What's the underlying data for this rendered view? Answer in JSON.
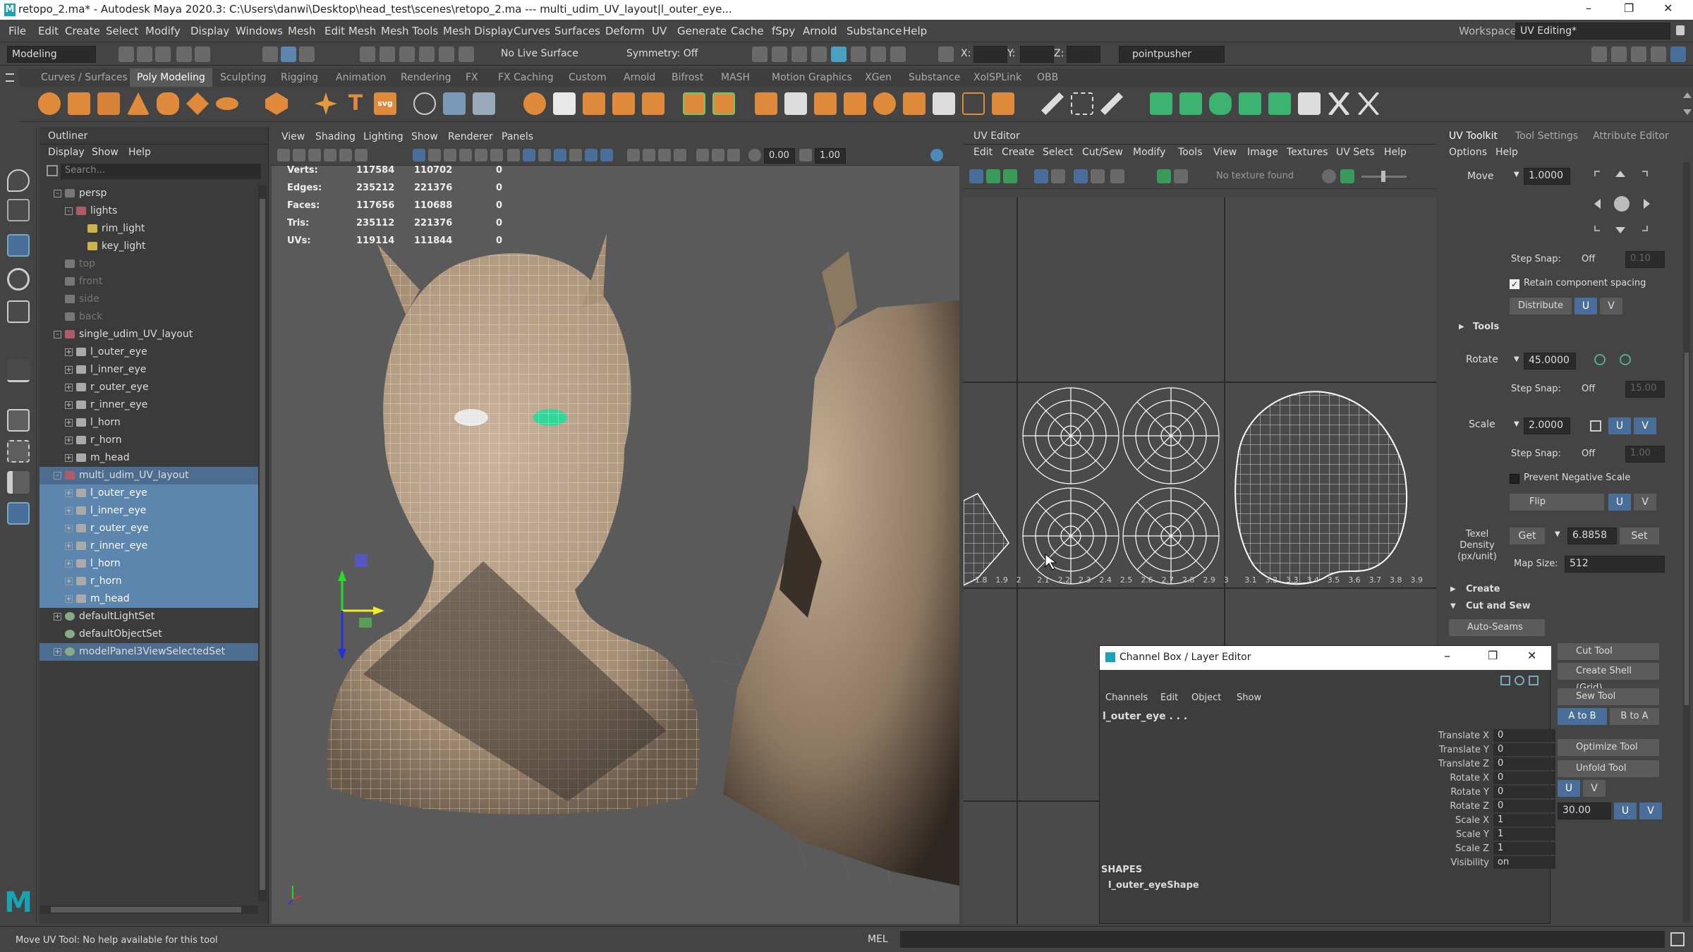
{
  "window": {
    "title": "retopo_2.ma* - Autodesk Maya 2020.3: C:\\Users\\danwi\\Desktop\\head_test\\scenes\\retopo_2.ma   ---   multi_udim_UV_layout|l_outer_eye...",
    "controls": [
      "–",
      "❐",
      "✕"
    ]
  },
  "menubar": {
    "items": [
      "File",
      "Edit",
      "Create",
      "Select",
      "Modify",
      "Display",
      "Windows",
      "Mesh",
      "Edit Mesh",
      "Mesh Tools",
      "Mesh Display",
      "Curves",
      "Surfaces",
      "Deform",
      "UV",
      "Generate",
      "Cache",
      "fSpy",
      "Arnold",
      "Substance",
      "Help"
    ],
    "workspace_label": "Workspace :",
    "workspace_value": "UV Editing*"
  },
  "statusline": {
    "menuset": "Modeling",
    "live_surface": "No Live Surface",
    "symmetry": "Symmetry: Off",
    "x_label": "X:",
    "y_label": "Y:",
    "z_label": "Z:",
    "user": "pointpusher"
  },
  "shelf_tabs": [
    "Curves / Surfaces",
    "Poly Modeling",
    "Sculpting",
    "Rigging",
    "Animation",
    "Rendering",
    "FX",
    "FX Caching",
    "Custom",
    "Arnold",
    "Bifrost",
    "MASH",
    "Motion Graphics",
    "XGen",
    "Substance",
    "XolSPLink",
    "OBB"
  ],
  "shelf_selected": "Poly Modeling",
  "outliner": {
    "title": "Outliner",
    "menu": [
      "Display",
      "Show",
      "Help"
    ],
    "search_placeholder": "Search...",
    "rows": [
      {
        "label": "persp",
        "indent": 1,
        "type": "cam",
        "exp": "-",
        "state": ""
      },
      {
        "label": "lights",
        "indent": 2,
        "type": "grp",
        "exp": "-",
        "state": ""
      },
      {
        "label": "rim_light",
        "indent": 3,
        "type": "light",
        "exp": "",
        "state": ""
      },
      {
        "label": "key_light",
        "indent": 3,
        "type": "light",
        "exp": "",
        "state": ""
      },
      {
        "label": "top",
        "indent": 1,
        "type": "cam",
        "exp": "",
        "state": "dim"
      },
      {
        "label": "front",
        "indent": 1,
        "type": "cam",
        "exp": "",
        "state": "dim"
      },
      {
        "label": "side",
        "indent": 1,
        "type": "cam",
        "exp": "",
        "state": "dim"
      },
      {
        "label": "back",
        "indent": 1,
        "type": "cam",
        "exp": "",
        "state": "dim"
      },
      {
        "label": "single_udim_UV_layout",
        "indent": 1,
        "type": "grp",
        "exp": "-",
        "state": ""
      },
      {
        "label": "l_outer_eye",
        "indent": 2,
        "type": "mesh",
        "exp": "+",
        "state": ""
      },
      {
        "label": "l_inner_eye",
        "indent": 2,
        "type": "mesh",
        "exp": "+",
        "state": ""
      },
      {
        "label": "r_outer_eye",
        "indent": 2,
        "type": "mesh",
        "exp": "+",
        "state": ""
      },
      {
        "label": "r_inner_eye",
        "indent": 2,
        "type": "mesh",
        "exp": "+",
        "state": ""
      },
      {
        "label": "l_horn",
        "indent": 2,
        "type": "mesh",
        "exp": "+",
        "state": ""
      },
      {
        "label": "r_horn",
        "indent": 2,
        "type": "mesh",
        "exp": "+",
        "state": ""
      },
      {
        "label": "m_head",
        "indent": 2,
        "type": "mesh",
        "exp": "+",
        "state": ""
      },
      {
        "label": "multi_udim_UV_layout",
        "indent": 1,
        "type": "grp",
        "exp": "-",
        "state": "selset"
      },
      {
        "label": "l_outer_eye",
        "indent": 2,
        "type": "mesh",
        "exp": "+",
        "state": "sel"
      },
      {
        "label": "l_inner_eye",
        "indent": 2,
        "type": "mesh",
        "exp": "+",
        "state": "sel"
      },
      {
        "label": "r_outer_eye",
        "indent": 2,
        "type": "mesh",
        "exp": "+",
        "state": "sel"
      },
      {
        "label": "r_inner_eye",
        "indent": 2,
        "type": "mesh",
        "exp": "+",
        "state": "sel"
      },
      {
        "label": "l_horn",
        "indent": 2,
        "type": "mesh",
        "exp": "+",
        "state": "sel"
      },
      {
        "label": "r_horn",
        "indent": 2,
        "type": "mesh",
        "exp": "+",
        "state": "sel"
      },
      {
        "label": "m_head",
        "indent": 2,
        "type": "mesh",
        "exp": "+",
        "state": "sel"
      },
      {
        "label": "defaultLightSet",
        "indent": 1,
        "type": "set",
        "exp": "+",
        "state": ""
      },
      {
        "label": "defaultObjectSet",
        "indent": 1,
        "type": "set",
        "exp": "",
        "state": ""
      },
      {
        "label": "modelPanel3ViewSelectedSet",
        "indent": 1,
        "type": "set",
        "exp": "+",
        "state": "selset"
      }
    ]
  },
  "viewport": {
    "menu": [
      "View",
      "Shading",
      "Lighting",
      "Show",
      "Renderer",
      "Panels"
    ],
    "field_a": "0.00",
    "field_b": "1.00",
    "hud": {
      "labels": [
        "Verts:",
        "Edges:",
        "Faces:",
        "Tris:",
        "UVs:"
      ],
      "col1": [
        "117584",
        "235212",
        "117656",
        "235112",
        "119114"
      ],
      "col2": [
        "110702",
        "221376",
        "110688",
        "221376",
        "111844"
      ],
      "col3": [
        "0",
        "0",
        "0",
        "0",
        "0"
      ]
    }
  },
  "uv_editor": {
    "title": "UV Editor",
    "menu": [
      "Edit",
      "Create",
      "Select",
      "Cut/Sew",
      "Modify",
      "Tools",
      "View",
      "Image",
      "Textures",
      "UV Sets",
      "Help"
    ],
    "texture_status": "No texture found",
    "udim_ticks": [
      "1.8",
      "1.9",
      "2",
      "2.1",
      "2.2",
      "2.3",
      "2.4",
      "2.5",
      "2.6",
      "2.7",
      "2.8",
      "2.9",
      "3",
      "3.1",
      "3.2",
      "3.3",
      "3.4",
      "3.5",
      "3.6",
      "3.7",
      "3.8",
      "3.9"
    ]
  },
  "uv_toolkit": {
    "tabs": [
      "UV Toolkit",
      "Tool Settings",
      "Attribute Editor"
    ],
    "menu": [
      "Options",
      "Help"
    ],
    "move_label": "Move",
    "move_value": "1.0000",
    "step_snap_label": "Step Snap:",
    "step_snap_value": "Off",
    "step_snap_num1": "0.10",
    "retain_label": "Retain component spacing",
    "distribute_label": "Distribute",
    "tools_section": "Tools",
    "rotate_label": "Rotate",
    "rotate_value": "45.0000",
    "step_snap_num2": "15.00",
    "scale_label": "Scale",
    "scale_value": "2.0000",
    "step_snap_num3": "1.00",
    "prevent_label": "Prevent Negative Scale",
    "flip_label": "Flip",
    "u": "U",
    "v": "V",
    "texel_label": "Texel Density (px/unit)",
    "get_label": "Get",
    "texel_value": "6.8858",
    "set_label": "Set",
    "map_size_label": "Map Size:",
    "map_size_value": "512",
    "create_section": "Create",
    "cut_sew_section": "Cut and Sew",
    "auto_seams": "Auto-Seams",
    "cut_tool": "Cut Tool",
    "create_shell": "Create Shell (Grid)",
    "sew_tool": "Sew Tool",
    "a_to_b": "A to B",
    "b_to_a": "B to A",
    "optimize_tool": "Optimize Tool",
    "unfold_tool": "Unfold Tool",
    "unfold_value": "30.00"
  },
  "channel_box": {
    "title": "Channel Box / Layer Editor",
    "menu": [
      "Channels",
      "Edit",
      "Object",
      "Show"
    ],
    "object": "l_outer_eye . . .",
    "attrs": [
      {
        "name": "Translate X",
        "value": "0"
      },
      {
        "name": "Translate Y",
        "value": "0"
      },
      {
        "name": "Translate Z",
        "value": "0"
      },
      {
        "name": "Rotate X",
        "value": "0"
      },
      {
        "name": "Rotate Y",
        "value": "0"
      },
      {
        "name": "Rotate Z",
        "value": "0"
      },
      {
        "name": "Scale X",
        "value": "1"
      },
      {
        "name": "Scale Y",
        "value": "1"
      },
      {
        "name": "Scale Z",
        "value": "1"
      },
      {
        "name": "Visibility",
        "value": "on"
      }
    ],
    "shapes_label": "SHAPES",
    "shape_name": "l_outer_eyeShape"
  },
  "helpline": {
    "text": "Move UV Tool: No help available for this tool",
    "mel": "MEL"
  }
}
